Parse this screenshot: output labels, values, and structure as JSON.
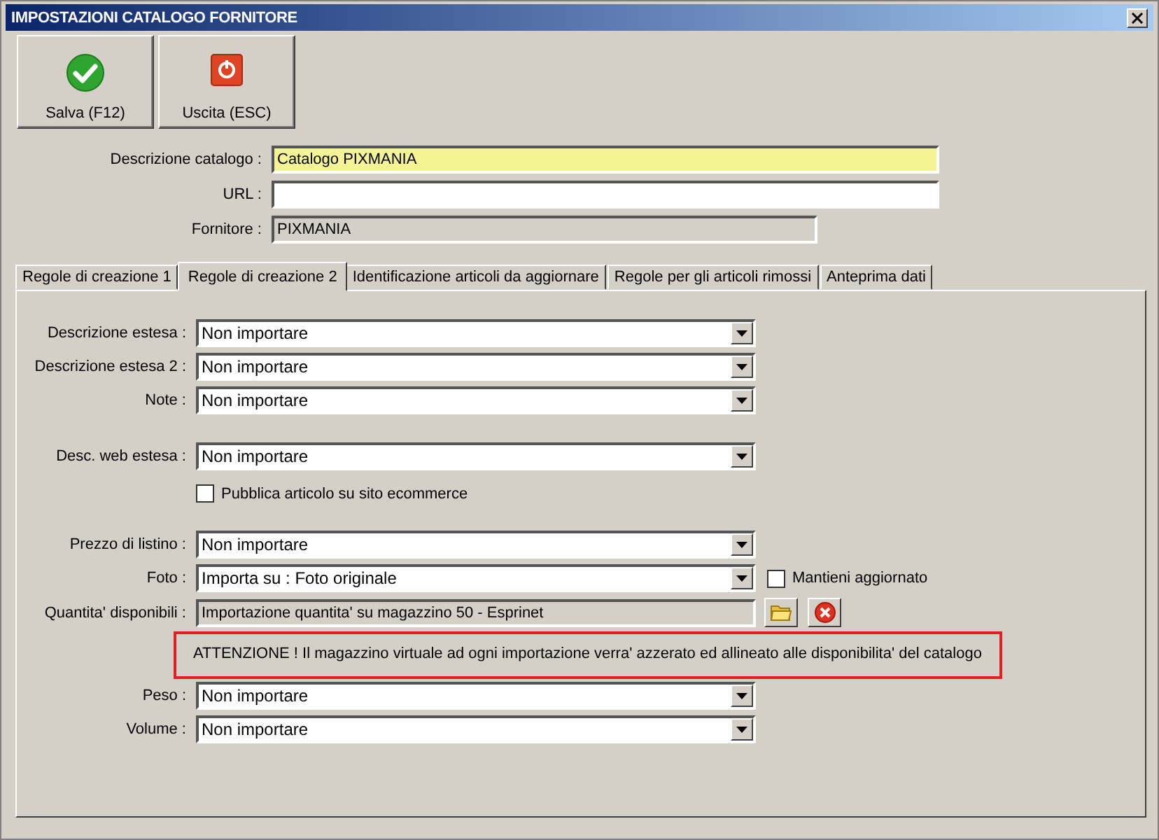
{
  "window": {
    "title": "IMPOSTAZIONI CATALOGO FORNITORE"
  },
  "toolbar": [
    {
      "kind": "save",
      "label": "Salva (F12)"
    },
    {
      "kind": "exit",
      "label": "Uscita (ESC)"
    }
  ],
  "header_fields": [
    {
      "kind": "required",
      "label": "Descrizione catalogo :",
      "value": "Catalogo PIXMANIA"
    },
    {
      "kind": "text",
      "label": "URL :"
    },
    {
      "kind": "readonly",
      "label": "Fornitore :",
      "value": "PIXMANIA"
    }
  ],
  "tabs": [
    {
      "label": "Regole di creazione 1",
      "selected": false
    },
    {
      "label": "Regole di creazione 2",
      "selected": true
    },
    {
      "label": "Identificazione articoli da aggiornare",
      "selected": false
    },
    {
      "label": "Regole per gli articoli rimossi",
      "selected": false
    },
    {
      "label": "Anteprima dati",
      "selected": false
    }
  ],
  "sections": [
    [
      {
        "kind": "select",
        "label": "Descrizione estesa :",
        "value": "Non importare"
      },
      {
        "kind": "select",
        "label": "Descrizione estesa 2 :",
        "value": "Non importare"
      },
      {
        "kind": "select",
        "label": "Note :",
        "value": "Non importare"
      }
    ],
    [
      {
        "kind": "select",
        "label": "Desc. web estesa :",
        "value": "Non importare"
      },
      {
        "kind": "checkbox",
        "label": "Pubblica articolo su sito ecommerce",
        "checked": false
      }
    ],
    [
      {
        "kind": "select",
        "label": "Prezzo di listino :",
        "value": "Non importare"
      },
      {
        "kind": "select",
        "label": "Foto :",
        "value": "Importa su : Foto originale",
        "option": {
          "label": "Mantieni aggiornato",
          "checked": false
        }
      },
      {
        "kind": "picker",
        "label": "Quantita' disponibili :",
        "value": "Importazione quantita' su magazzino 50 - Esprinet"
      },
      {
        "kind": "warning",
        "text": "ATTENZIONE ! Il magazzino virtuale ad ogni importazione verra' azzerato ed allineato alle disponibilita' del catalogo"
      },
      {
        "kind": "select",
        "label": "Peso :",
        "value": "Non importare"
      },
      {
        "kind": "select",
        "label": "Volume :",
        "value": "Non importare"
      }
    ]
  ]
}
